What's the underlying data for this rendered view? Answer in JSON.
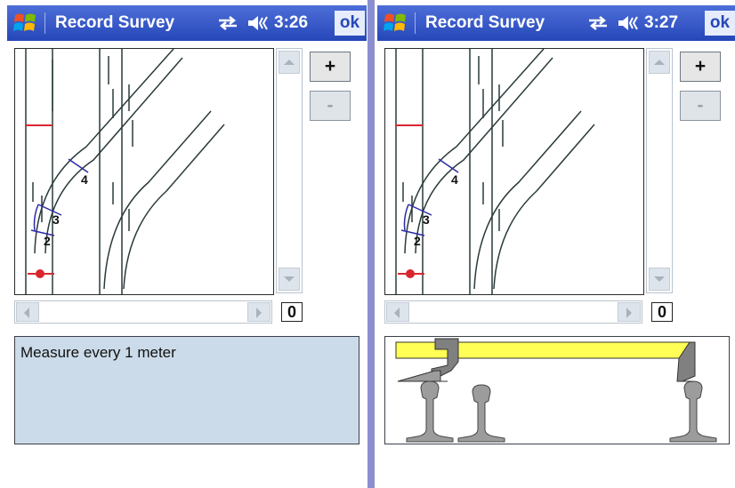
{
  "colors": {
    "titlebar": "#2f50c4",
    "survey_line": "#2a3a3a",
    "marker_red": "#d9262c",
    "measure_blue": "#2a2aa8",
    "message_bg": "#ccdbe9",
    "platform_yellow": "#ffff55",
    "rail_gray": "#9c9c9c"
  },
  "screens": [
    {
      "titlebar": {
        "start_icon": "windows-flag-icon",
        "app_title": "Record Survey",
        "status_icons": [
          "sync-arrows-icon",
          "speaker-icon"
        ],
        "time": "3:26",
        "ok_label": "ok"
      },
      "drawing": {
        "station_labels": [
          "4",
          "3",
          "2"
        ]
      },
      "zoom_in_label": "+",
      "zoom_out_label": "-",
      "zero_label": "0",
      "message": "Measure every 1 meter"
    },
    {
      "titlebar": {
        "start_icon": "windows-flag-icon",
        "app_title": "Record Survey",
        "status_icons": [
          "sync-arrows-icon",
          "speaker-icon"
        ],
        "time": "3:27",
        "ok_label": "ok"
      },
      "drawing": {
        "station_labels": [
          "4",
          "3",
          "2"
        ]
      },
      "zoom_in_label": "+",
      "zoom_out_label": "-",
      "zero_label": "0",
      "profile": {
        "elements": [
          "platform-slab",
          "rail-profile",
          "rail-profile",
          "rail-profile"
        ]
      }
    }
  ]
}
